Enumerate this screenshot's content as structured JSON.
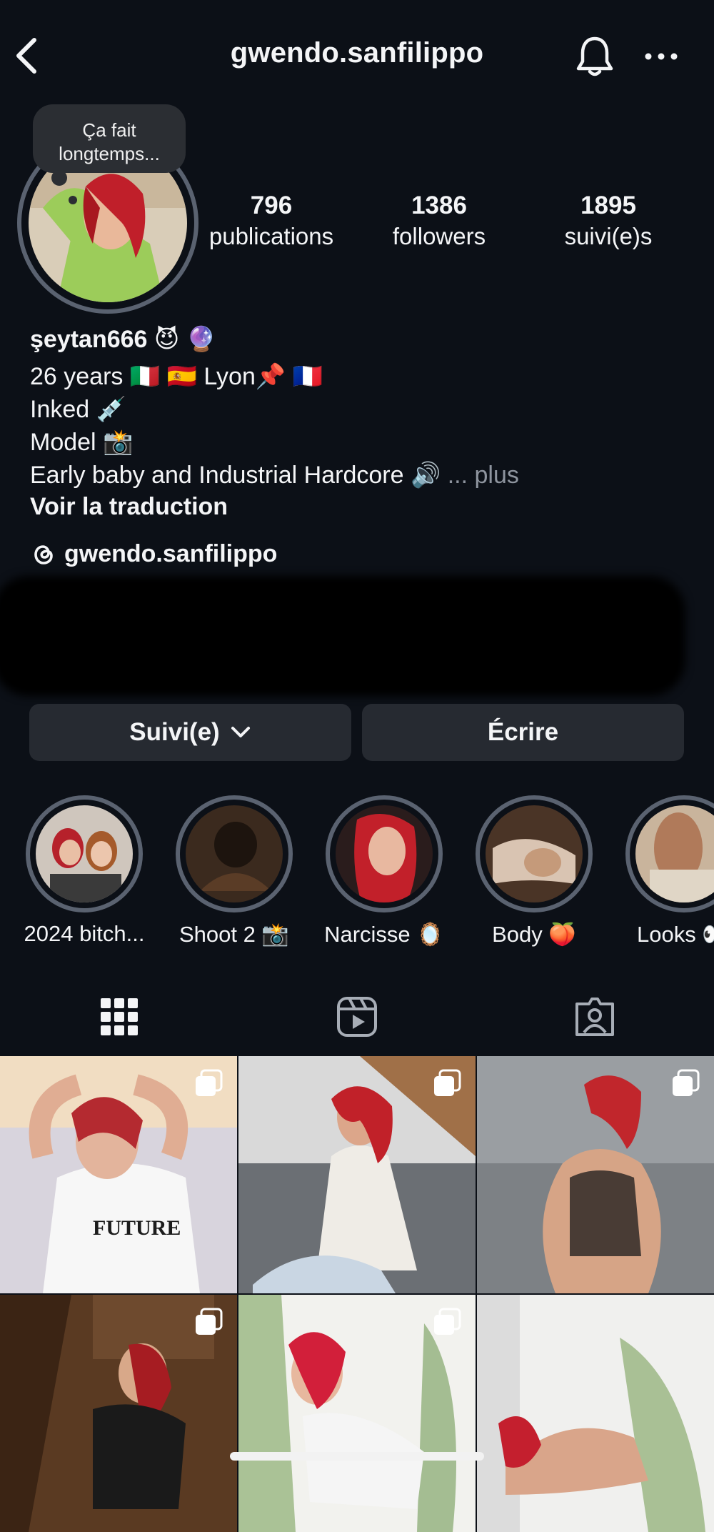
{
  "header": {
    "username": "gwendo.sanfilippo"
  },
  "note": {
    "text": "Ça fait longtemps..."
  },
  "stats": [
    {
      "value": "796",
      "label": "publications"
    },
    {
      "value": "1386",
      "label": "followers"
    },
    {
      "value": "1895",
      "label": "suivi(e)s"
    }
  ],
  "bio": {
    "name": "şeytan666 😈 🔮",
    "lines": [
      "26 years 🇮🇹 🇪🇸 Lyon📌 🇫🇷",
      "Inked 💉",
      "Model 📸",
      "Early baby and Industrial Hardcore 🔊"
    ],
    "more": "... plus",
    "translate": "Voir la traduction",
    "threads_handle": "gwendo.sanfilippo"
  },
  "actions": {
    "follow_label": "Suivi(e)",
    "message_label": "Écrire"
  },
  "highlights": [
    {
      "label": "2024 bitch..."
    },
    {
      "label": "Shoot 2 📸"
    },
    {
      "label": "Narcisse 🪞"
    },
    {
      "label": "Body 🍑"
    },
    {
      "label": "Looks 👀"
    }
  ],
  "tabs": {
    "icons": [
      "grid-icon",
      "reels-icon",
      "tagged-icon"
    ]
  },
  "colors": {
    "background": "#0c1017",
    "button": "#262a31",
    "ring": "#5a6270",
    "muted_text": "#8e949e"
  }
}
